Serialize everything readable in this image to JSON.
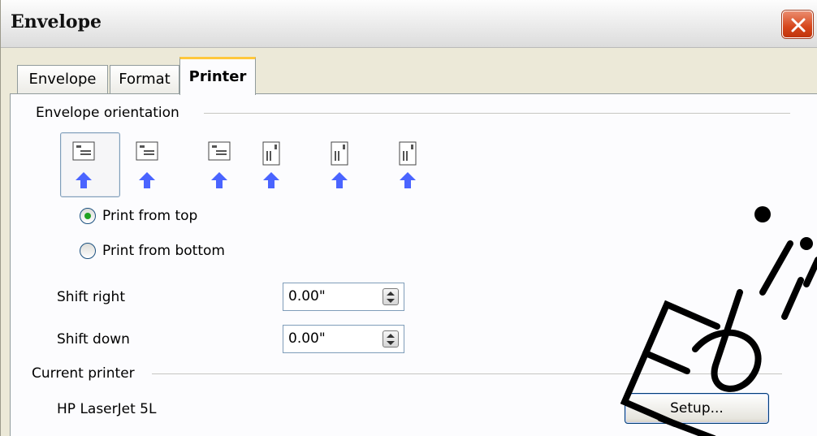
{
  "window": {
    "title": "Envelope"
  },
  "tabs": [
    {
      "label": "Envelope",
      "active": false
    },
    {
      "label": "Format",
      "active": false
    },
    {
      "label": "Printer",
      "active": true
    }
  ],
  "orientation": {
    "group_label": "Envelope orientation",
    "options": [
      {
        "icon": "envelope-landscape-left-icon",
        "selected": true
      },
      {
        "icon": "envelope-landscape-center-icon",
        "selected": false
      },
      {
        "icon": "envelope-landscape-right-icon",
        "selected": false
      },
      {
        "icon": "envelope-portrait-left-icon",
        "selected": false
      },
      {
        "icon": "envelope-portrait-center-icon",
        "selected": false
      },
      {
        "icon": "envelope-portrait-right-icon",
        "selected": false
      }
    ],
    "print_from_top": {
      "label": "Print from top",
      "checked": true
    },
    "print_from_bottom": {
      "label": "Print from bottom",
      "checked": false
    }
  },
  "shift_right": {
    "label": "Shift right",
    "value": "0.00\""
  },
  "shift_down": {
    "label": "Shift down",
    "value": "0.00\""
  },
  "current_printer": {
    "group_label": "Current printer",
    "name": "HP LaserJet 5L",
    "setup_label": "Setup..."
  },
  "watermark": {
    "text": "Editio"
  },
  "colors": {
    "arrow": "#4a64ff",
    "radio_dot": "#21a121",
    "tab_highlight": "#ffc83c",
    "close": "#d6461b"
  }
}
